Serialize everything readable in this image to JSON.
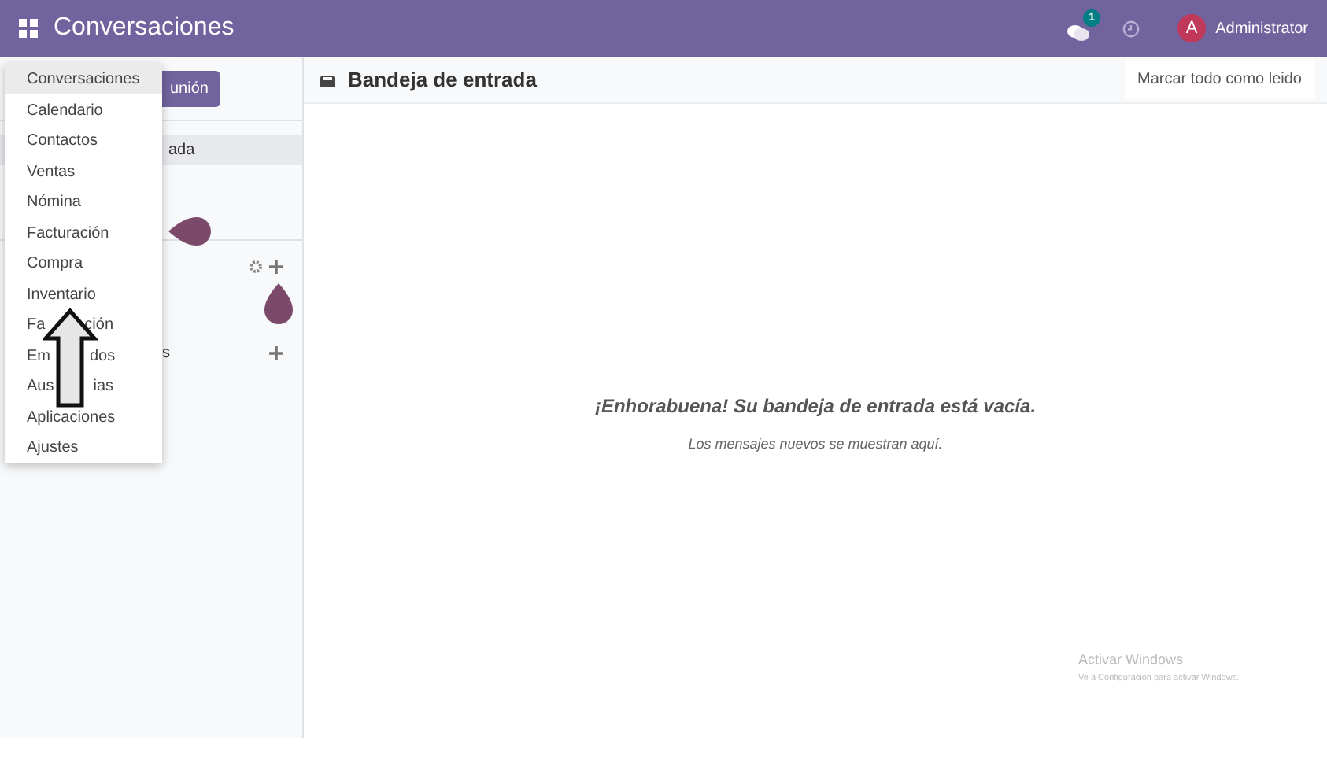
{
  "navbar": {
    "app_title": "Conversaciones",
    "notification_count": "1",
    "user_initial": "A",
    "user_name": "Administrator"
  },
  "app_menu": {
    "items": [
      {
        "label": "Conversaciones",
        "selected": true
      },
      {
        "label": "Calendario",
        "selected": false
      },
      {
        "label": "Contactos",
        "selected": false
      },
      {
        "label": "Ventas",
        "selected": false
      },
      {
        "label": "Nómina",
        "selected": false
      },
      {
        "label": "Facturación",
        "selected": false
      },
      {
        "label": "Compra",
        "selected": false
      },
      {
        "label": "Inventario",
        "selected": false
      },
      {
        "label": "Fa",
        "tail": "ción",
        "selected": false
      },
      {
        "label": "Em",
        "tail": "dos",
        "selected": false
      },
      {
        "label": "Aus",
        "tail": "ias",
        "selected": false
      },
      {
        "label": "Aplicaciones",
        "selected": false
      },
      {
        "label": "Ajustes",
        "selected": false
      }
    ]
  },
  "sidebar": {
    "button_text": "unión",
    "inbox_row": {
      "text": "ada",
      "selected": true
    },
    "dm_header": {
      "text": "s"
    }
  },
  "main": {
    "title": "Bandeja de entrada",
    "mark_all": "Marcar todo como leido",
    "empty_title": "¡Enhorabuena! Su bandeja de entrada está vacía.",
    "empty_text": "Los mensajes nuevos se muestran aquí."
  },
  "windows_notice": {
    "title": "Activar Windows",
    "text": "Ve a Configuración para activar Windows."
  }
}
